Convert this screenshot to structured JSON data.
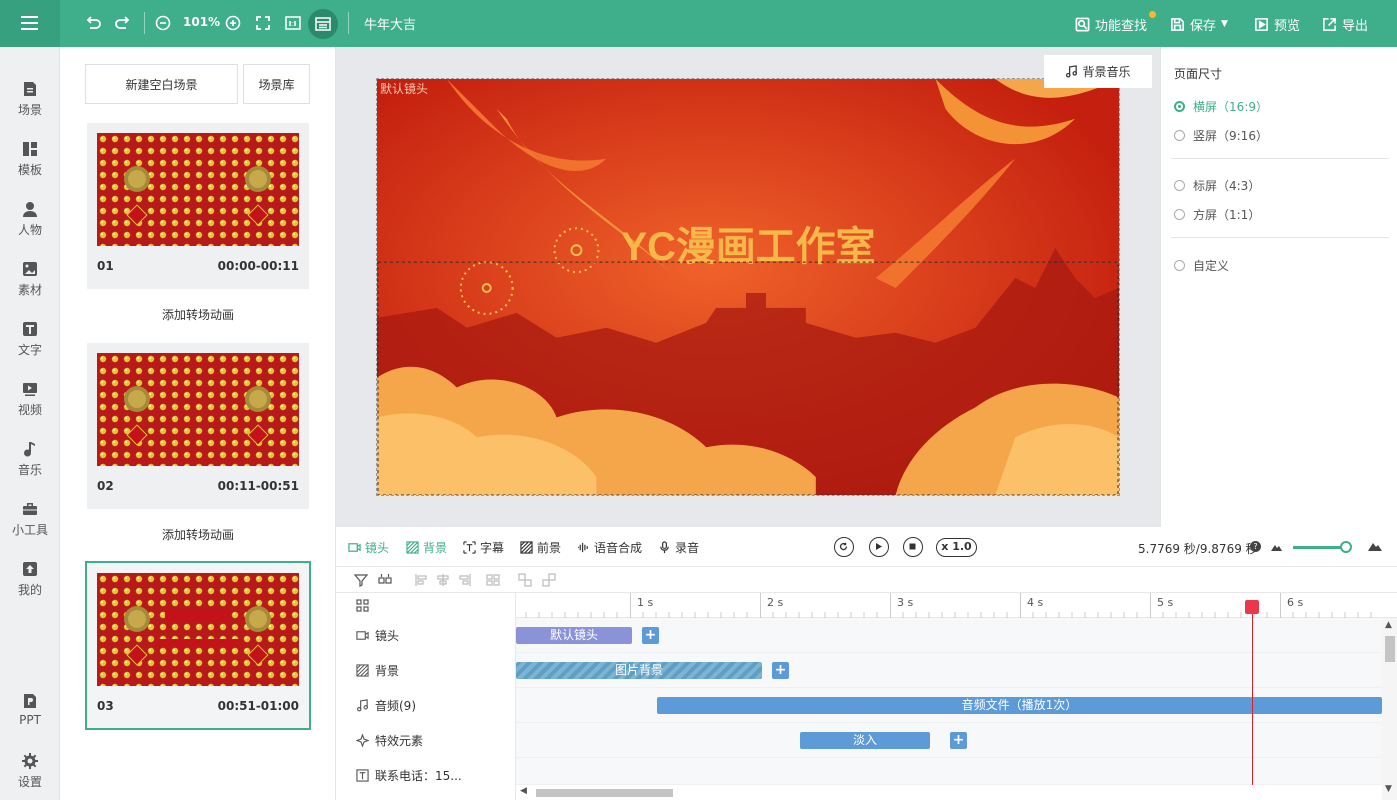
{
  "app": {
    "project_name": "牛年大吉",
    "zoom": "101%"
  },
  "topbar": {
    "feature_search": "功能查找",
    "save": "保存",
    "preview": "预览",
    "export": "导出"
  },
  "leftnav": {
    "items": [
      {
        "label": "场景",
        "icon": "scene-icon"
      },
      {
        "label": "模板",
        "icon": "template-icon"
      },
      {
        "label": "人物",
        "icon": "person-icon"
      },
      {
        "label": "素材",
        "icon": "material-icon"
      },
      {
        "label": "文字",
        "icon": "text-icon"
      },
      {
        "label": "视频",
        "icon": "video-icon"
      },
      {
        "label": "音乐",
        "icon": "music-icon"
      },
      {
        "label": "小工具",
        "icon": "toolbox-icon"
      },
      {
        "label": "我的",
        "icon": "upload-icon"
      }
    ],
    "ppt": "PPT",
    "settings": "设置"
  },
  "scene_panel": {
    "new_scene": "新建空白场景",
    "library": "场景库",
    "scenes": [
      {
        "num": "01",
        "time": "00:00-00:11"
      },
      {
        "num": "02",
        "time": "00:11-00:51"
      },
      {
        "num": "03",
        "time": "00:51-01:00"
      }
    ],
    "transition": "添加转场动画"
  },
  "canvas": {
    "camera_label": "默认镜头",
    "bgm_button": "背景音乐",
    "title_text": "YC漫画工作室"
  },
  "page_size": {
    "title": "页面尺寸",
    "options": [
      {
        "label": "横屏（16:9）",
        "selected": true
      },
      {
        "label": "竖屏（9:16）",
        "selected": false
      },
      {
        "label": "标屏（4:3）",
        "selected": false
      },
      {
        "label": "方屏（1:1）",
        "selected": false
      },
      {
        "label": "自定义",
        "selected": false
      }
    ]
  },
  "timeline": {
    "tabs": [
      "镜头",
      "背景",
      "字幕",
      "前景",
      "语音合成",
      "录音"
    ],
    "active_tab": "背景",
    "speed": "x 1.0",
    "time_readout": "5.7769 秒/9.8769 秒",
    "ruler_labels": [
      "1 s",
      "2 s",
      "3 s",
      "4 s",
      "5 s",
      "6 s"
    ],
    "rows": [
      {
        "label": "镜头",
        "icon": "camera-icon"
      },
      {
        "label": "背景",
        "icon": "background-icon"
      },
      {
        "label": "音频(9)",
        "icon": "music-icon"
      },
      {
        "label": "特效元素",
        "icon": "sparkle-icon"
      },
      {
        "label": "联系电话：15...",
        "icon": "text-icon"
      }
    ],
    "clips": {
      "camera": "默认镜头",
      "background": "图片背景",
      "audio": "音频文件（播放1次）",
      "fx": "淡入"
    },
    "zoom_level": 0.9
  },
  "colors": {
    "accent": "#3fae8b",
    "playhead": "#d8212a",
    "clip": "#5d9ad8"
  }
}
